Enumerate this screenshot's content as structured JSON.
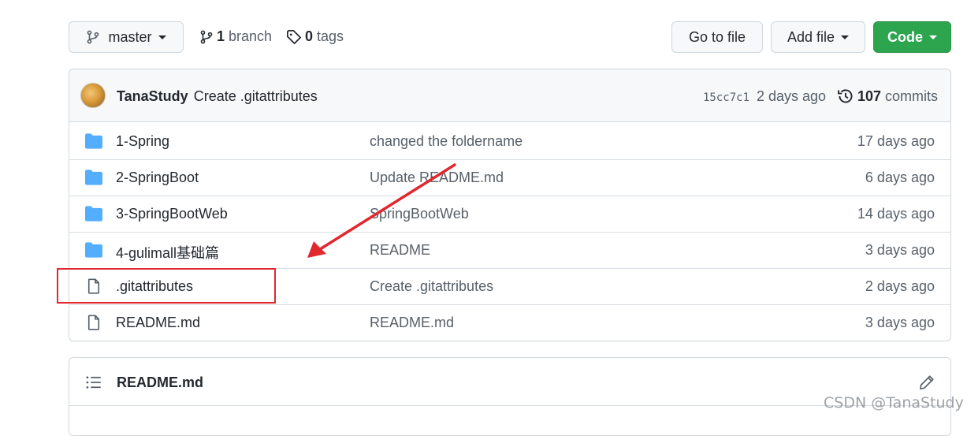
{
  "toolbar": {
    "branch_selector": "master",
    "branch_count": "1",
    "branch_label": "branch",
    "tag_count": "0",
    "tag_label": "tags",
    "go_to_file": "Go to file",
    "add_file": "Add file",
    "code": "Code"
  },
  "commit": {
    "author": "TanaStudy",
    "message": "Create .gitattributes",
    "sha": "15cc7c1",
    "age": "2 days ago",
    "count": "107",
    "count_label": "commits"
  },
  "files": [
    {
      "type": "folder",
      "name": "1-Spring",
      "message": "changed the foldername",
      "age": "17 days ago"
    },
    {
      "type": "folder",
      "name": "2-SpringBoot",
      "message": "Update README.md",
      "age": "6 days ago"
    },
    {
      "type": "folder",
      "name": "3-SpringBootWeb",
      "message": "SpringBootWeb",
      "age": "14 days ago"
    },
    {
      "type": "folder",
      "name": "4-gulimall基础篇",
      "message": "README",
      "age": "3 days ago"
    },
    {
      "type": "file",
      "name": ".gitattributes",
      "message": "Create .gitattributes",
      "age": "2 days ago"
    },
    {
      "type": "file",
      "name": "README.md",
      "message": "README.md",
      "age": "3 days ago"
    }
  ],
  "readme": {
    "title": "README.md"
  },
  "watermark": "CSDN @TanaStudy",
  "colors": {
    "accent_green": "#2da44e",
    "folder_blue": "#54aeff",
    "annotation_red": "#e0282e",
    "muted_text": "#57606a"
  }
}
